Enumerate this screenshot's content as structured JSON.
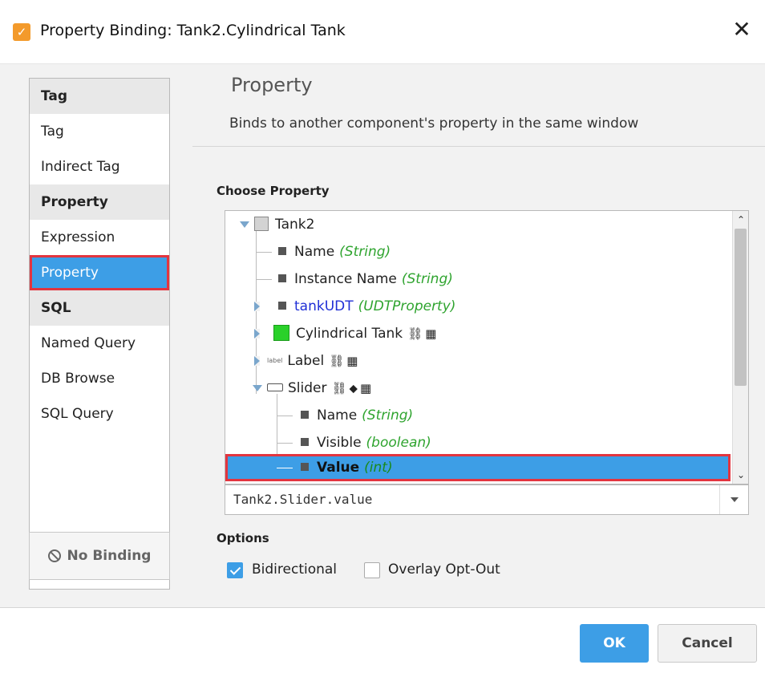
{
  "window": {
    "title": "Property Binding: Tank2.Cylindrical Tank",
    "close_icon": "close-icon",
    "app_icon": "binding-app-icon"
  },
  "sidebar": {
    "groups": [
      {
        "header": "Tag",
        "items": [
          "Tag",
          "Indirect Tag"
        ]
      },
      {
        "header": "Property",
        "items": [
          "Expression",
          "Property"
        ]
      },
      {
        "header": "SQL",
        "items": [
          "Named Query",
          "DB Browse",
          "SQL Query"
        ]
      }
    ],
    "selected": "Property",
    "no_binding_label": "No Binding"
  },
  "panel": {
    "title": "Property",
    "description": "Binds to another component's property in the same window"
  },
  "choose_property": {
    "label": "Choose Property",
    "tree": {
      "root": "Tank2",
      "name": {
        "label": "Name",
        "type": "(String)"
      },
      "instance_name": {
        "label": "Instance Name",
        "type": "(String)"
      },
      "tankudt": {
        "label": "tankUDT",
        "type": "(UDTProperty)"
      },
      "cylindrical_tank": {
        "label": "Cylindrical Tank"
      },
      "label": {
        "label": "Label",
        "icon_text": "label"
      },
      "slider": {
        "label": "Slider"
      },
      "slider_name": {
        "label": "Name",
        "type": "(String)"
      },
      "slider_visible": {
        "label": "Visible",
        "type": "(boolean)"
      },
      "slider_value": {
        "label": "Value",
        "type": "(int)"
      }
    },
    "path_value": "Tank2.Slider.value"
  },
  "options": {
    "label": "Options",
    "bidirectional": {
      "label": "Bidirectional",
      "checked": true
    },
    "overlay_opt_out": {
      "label": "Overlay Opt-Out",
      "checked": false
    }
  },
  "buttons": {
    "ok": "OK",
    "cancel": "Cancel"
  },
  "colors": {
    "accent": "#3d9ee6",
    "highlight_border": "#e3353f",
    "type_text": "#2fa42f",
    "link_text": "#1f2fd6"
  }
}
